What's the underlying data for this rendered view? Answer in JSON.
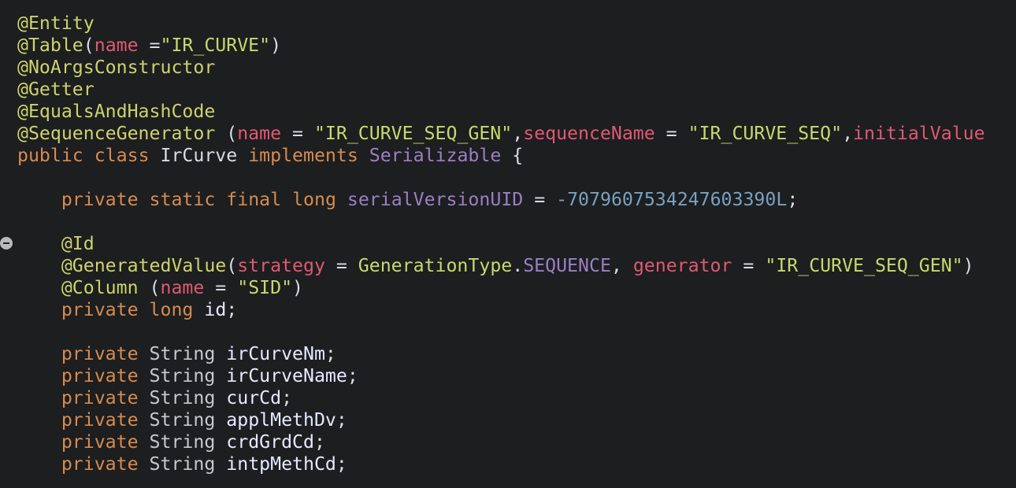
{
  "editor": {
    "lines": [
      [
        {
          "t": "@Entity",
          "c": "ann"
        }
      ],
      [
        {
          "t": "@Table",
          "c": "ann"
        },
        {
          "t": "(",
          "c": "punct"
        },
        {
          "t": "name",
          "c": "attr"
        },
        {
          "t": " =",
          "c": "punct"
        },
        {
          "t": "\"IR_CURVE\"",
          "c": "str"
        },
        {
          "t": ")",
          "c": "punct"
        }
      ],
      [
        {
          "t": "@NoArgsConstructor",
          "c": "ann"
        }
      ],
      [
        {
          "t": "@Getter",
          "c": "ann"
        }
      ],
      [
        {
          "t": "@EqualsAndHashCode",
          "c": "ann"
        }
      ],
      [
        {
          "t": "@SequenceGenerator",
          "c": "ann"
        },
        {
          "t": " (",
          "c": "punct"
        },
        {
          "t": "name",
          "c": "attr"
        },
        {
          "t": " = ",
          "c": "punct"
        },
        {
          "t": "\"IR_CURVE_SEQ_GEN\"",
          "c": "str"
        },
        {
          "t": ",",
          "c": "punct"
        },
        {
          "t": "sequenceName",
          "c": "attr"
        },
        {
          "t": " = ",
          "c": "punct"
        },
        {
          "t": "\"IR_CURVE_SEQ\"",
          "c": "str"
        },
        {
          "t": ",",
          "c": "punct"
        },
        {
          "t": "initialValue",
          "c": "attr"
        }
      ],
      [
        {
          "t": "public",
          "c": "kw"
        },
        {
          "t": " ",
          "c": "plain"
        },
        {
          "t": "class",
          "c": "kw"
        },
        {
          "t": " IrCurve ",
          "c": "plain"
        },
        {
          "t": "implements",
          "c": "kw"
        },
        {
          "t": " ",
          "c": "plain"
        },
        {
          "t": "Serializable",
          "c": "cls"
        },
        {
          "t": " {",
          "c": "punct"
        }
      ],
      [],
      [
        {
          "t": "    ",
          "c": "plain"
        },
        {
          "t": "private",
          "c": "kw"
        },
        {
          "t": " ",
          "c": "plain"
        },
        {
          "t": "static",
          "c": "kw"
        },
        {
          "t": " ",
          "c": "plain"
        },
        {
          "t": "final",
          "c": "kw"
        },
        {
          "t": " ",
          "c": "plain"
        },
        {
          "t": "long",
          "c": "kw"
        },
        {
          "t": " ",
          "c": "plain"
        },
        {
          "t": "serialVersionUID",
          "c": "cls"
        },
        {
          "t": " = ",
          "c": "punct"
        },
        {
          "t": "-7079607534247603390L",
          "c": "num"
        },
        {
          "t": ";",
          "c": "punct"
        }
      ],
      [],
      [
        {
          "t": "    ",
          "c": "plain"
        },
        {
          "t": "@Id",
          "c": "ann"
        }
      ],
      [
        {
          "t": "    ",
          "c": "plain"
        },
        {
          "t": "@GeneratedValue",
          "c": "ann"
        },
        {
          "t": "(",
          "c": "punct"
        },
        {
          "t": "strategy",
          "c": "attr"
        },
        {
          "t": " = ",
          "c": "punct"
        },
        {
          "t": "GenerationType",
          "c": "type"
        },
        {
          "t": ".",
          "c": "punct"
        },
        {
          "t": "SEQUENCE",
          "c": "enum"
        },
        {
          "t": ", ",
          "c": "punct"
        },
        {
          "t": "generator",
          "c": "attr"
        },
        {
          "t": " = ",
          "c": "punct"
        },
        {
          "t": "\"IR_CURVE_SEQ_GEN\"",
          "c": "str"
        },
        {
          "t": ")",
          "c": "punct"
        }
      ],
      [
        {
          "t": "    ",
          "c": "plain"
        },
        {
          "t": "@Column",
          "c": "ann"
        },
        {
          "t": " (",
          "c": "punct"
        },
        {
          "t": "name",
          "c": "attr"
        },
        {
          "t": " = ",
          "c": "punct"
        },
        {
          "t": "\"SID\"",
          "c": "str"
        },
        {
          "t": ")",
          "c": "punct"
        }
      ],
      [
        {
          "t": "    ",
          "c": "plain"
        },
        {
          "t": "private",
          "c": "kw"
        },
        {
          "t": " ",
          "c": "plain"
        },
        {
          "t": "long",
          "c": "kw"
        },
        {
          "t": " ",
          "c": "plain"
        },
        {
          "t": "id",
          "c": "ident"
        },
        {
          "t": ";",
          "c": "punct"
        }
      ],
      [],
      [
        {
          "t": "    ",
          "c": "plain"
        },
        {
          "t": "private",
          "c": "kw"
        },
        {
          "t": " ",
          "c": "plain"
        },
        {
          "t": "String",
          "c": "strtype"
        },
        {
          "t": " ",
          "c": "plain"
        },
        {
          "t": "irCurveNm",
          "c": "ident"
        },
        {
          "t": ";",
          "c": "punct"
        }
      ],
      [
        {
          "t": "    ",
          "c": "plain"
        },
        {
          "t": "private",
          "c": "kw"
        },
        {
          "t": " ",
          "c": "plain"
        },
        {
          "t": "String",
          "c": "strtype"
        },
        {
          "t": " ",
          "c": "plain"
        },
        {
          "t": "irCurveName",
          "c": "ident"
        },
        {
          "t": ";",
          "c": "punct"
        }
      ],
      [
        {
          "t": "    ",
          "c": "plain"
        },
        {
          "t": "private",
          "c": "kw"
        },
        {
          "t": " ",
          "c": "plain"
        },
        {
          "t": "String",
          "c": "strtype"
        },
        {
          "t": " ",
          "c": "plain"
        },
        {
          "t": "curCd",
          "c": "ident"
        },
        {
          "t": ";",
          "c": "punct"
        }
      ],
      [
        {
          "t": "    ",
          "c": "plain"
        },
        {
          "t": "private",
          "c": "kw"
        },
        {
          "t": " ",
          "c": "plain"
        },
        {
          "t": "String",
          "c": "strtype"
        },
        {
          "t": " ",
          "c": "plain"
        },
        {
          "t": "applMethDv",
          "c": "ident"
        },
        {
          "t": ";",
          "c": "punct"
        }
      ],
      [
        {
          "t": "    ",
          "c": "plain"
        },
        {
          "t": "private",
          "c": "kw"
        },
        {
          "t": " ",
          "c": "plain"
        },
        {
          "t": "String",
          "c": "strtype"
        },
        {
          "t": " ",
          "c": "plain"
        },
        {
          "t": "crdGrdCd",
          "c": "ident"
        },
        {
          "t": ";",
          "c": "punct"
        }
      ],
      [
        {
          "t": "    ",
          "c": "plain"
        },
        {
          "t": "private",
          "c": "kw"
        },
        {
          "t": " ",
          "c": "plain"
        },
        {
          "t": "String",
          "c": "strtype"
        },
        {
          "t": " ",
          "c": "plain"
        },
        {
          "t": "intpMethCd",
          "c": "ident"
        },
        {
          "t": ";",
          "c": "punct"
        }
      ]
    ]
  },
  "gutter": {
    "fold_icon": "collapse-fold-icon"
  }
}
